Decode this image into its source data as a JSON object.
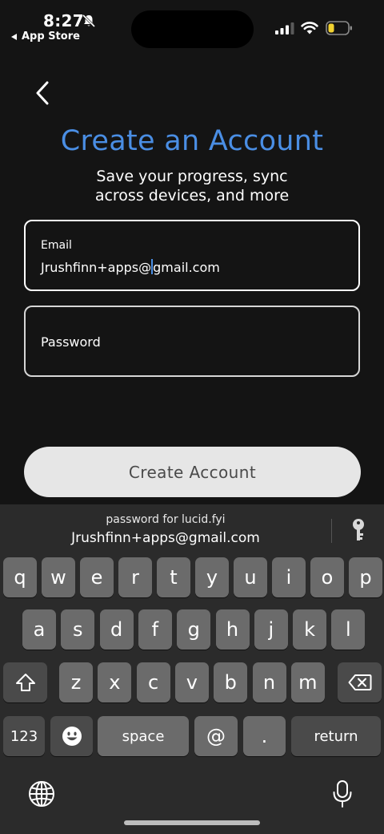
{
  "status_bar": {
    "time": "8:27",
    "back_app": "App Store"
  },
  "page": {
    "title": "Create an Account",
    "subtitle": "Save your progress, sync\nacross devices, and more",
    "email_label": "Email",
    "email_before_cursor": "Jrushfinn+apps@",
    "email_after_cursor": "gmail.com",
    "password_label": "Password",
    "create_button": "Create Account",
    "accent_color": "#4a8ee4"
  },
  "keyboard": {
    "suggestion_caption": "password for lucid.fyi",
    "suggestion_email": "Jrushfinn+apps@gmail.com",
    "row1": [
      "q",
      "w",
      "e",
      "r",
      "t",
      "y",
      "u",
      "i",
      "o",
      "p"
    ],
    "row2": [
      "a",
      "s",
      "d",
      "f",
      "g",
      "h",
      "j",
      "k",
      "l"
    ],
    "row3": [
      "z",
      "x",
      "c",
      "v",
      "b",
      "n",
      "m"
    ],
    "numbers_key": "123",
    "space_key": "space",
    "at_key": "@",
    "period_key": ".",
    "return_key": "return"
  }
}
